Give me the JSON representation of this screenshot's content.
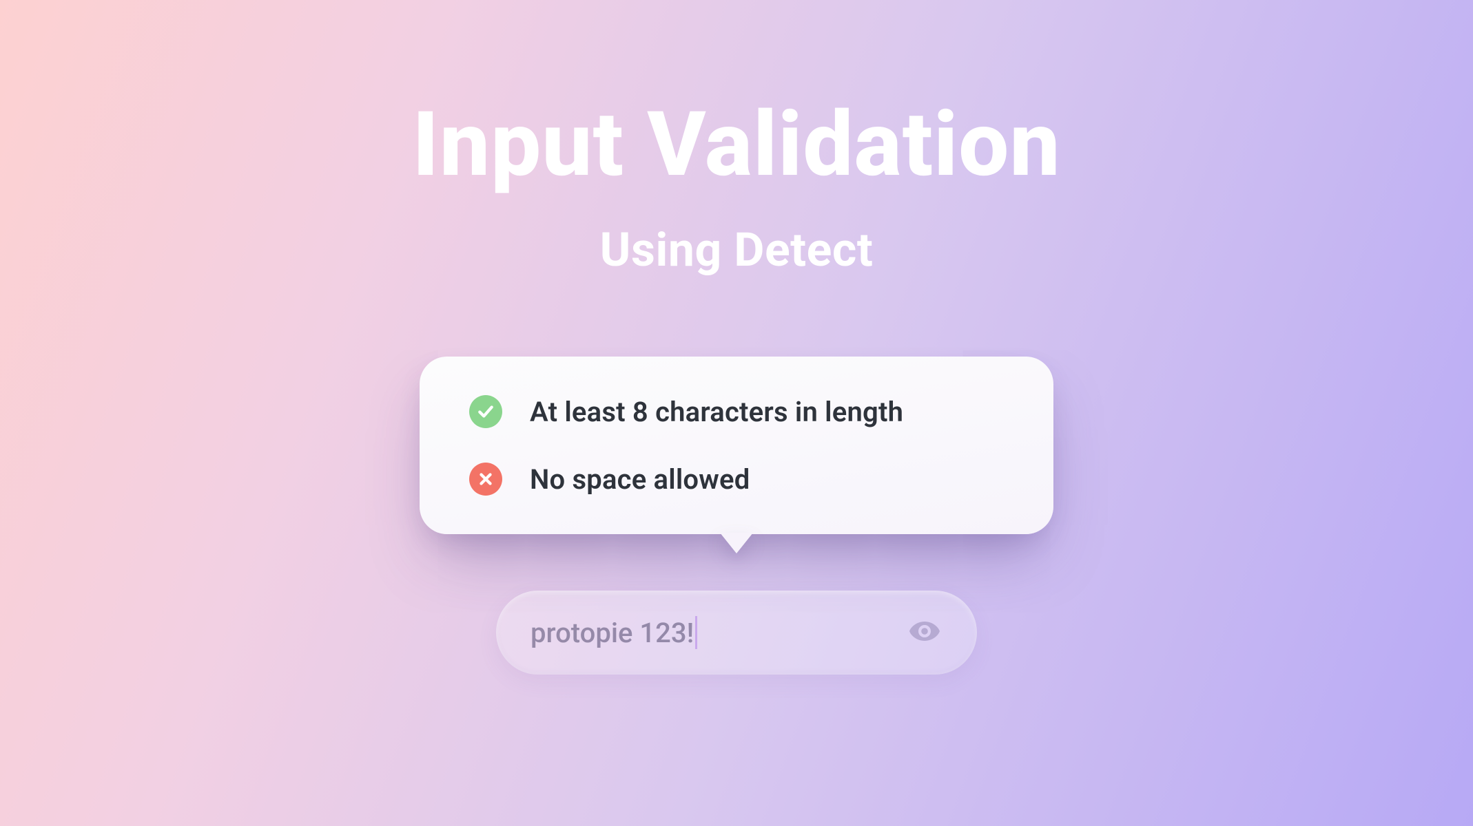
{
  "header": {
    "title": "Input Validation",
    "subtitle": "Using Detect"
  },
  "tooltip": {
    "rules": [
      {
        "status": "pass",
        "text": "At least 8 characters in length"
      },
      {
        "status": "fail",
        "text": "No space allowed"
      }
    ]
  },
  "input": {
    "value": "protopie 123!"
  },
  "colors": {
    "pass": "#8ad58d",
    "fail": "#f37366",
    "text": "#2e333b"
  }
}
